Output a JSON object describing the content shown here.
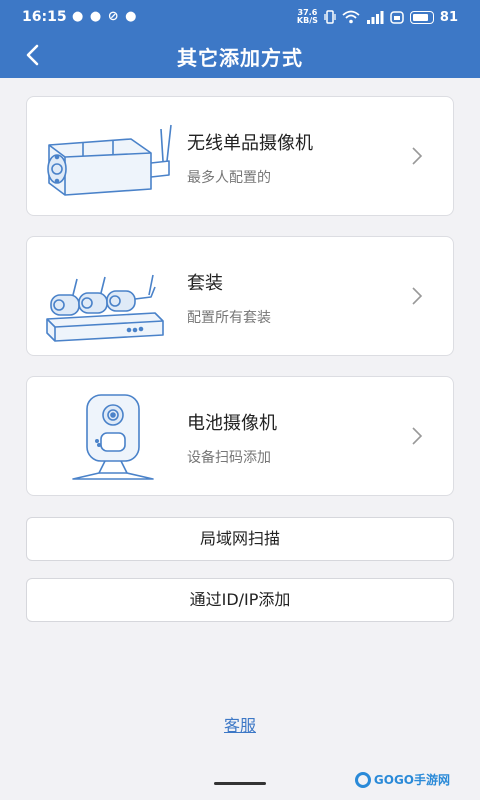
{
  "status_bar": {
    "time": "16:15",
    "notifications": "● ● ⊘ ●",
    "net_speed_value": "37.6",
    "net_speed_unit": "KB/S",
    "battery_level": "81"
  },
  "header": {
    "title": "其它添加方式"
  },
  "options": [
    {
      "title": "无线单品摄像机",
      "subtitle": "最多人配置的",
      "icon": "wireless-camera-icon"
    },
    {
      "title": "套装",
      "subtitle": "配置所有套装",
      "icon": "nvr-kit-icon"
    },
    {
      "title": "电池摄像机",
      "subtitle": "设备扫码添加",
      "icon": "battery-camera-icon"
    }
  ],
  "buttons": {
    "lan_scan": "局域网扫描",
    "add_by_ip": "通过ID/IP添加"
  },
  "customer_service": "客服",
  "watermark": "GOGO手游网",
  "colors": {
    "accent": "#3d78c6",
    "background": "#f2f2f5",
    "line_art": "#4a82c9"
  }
}
